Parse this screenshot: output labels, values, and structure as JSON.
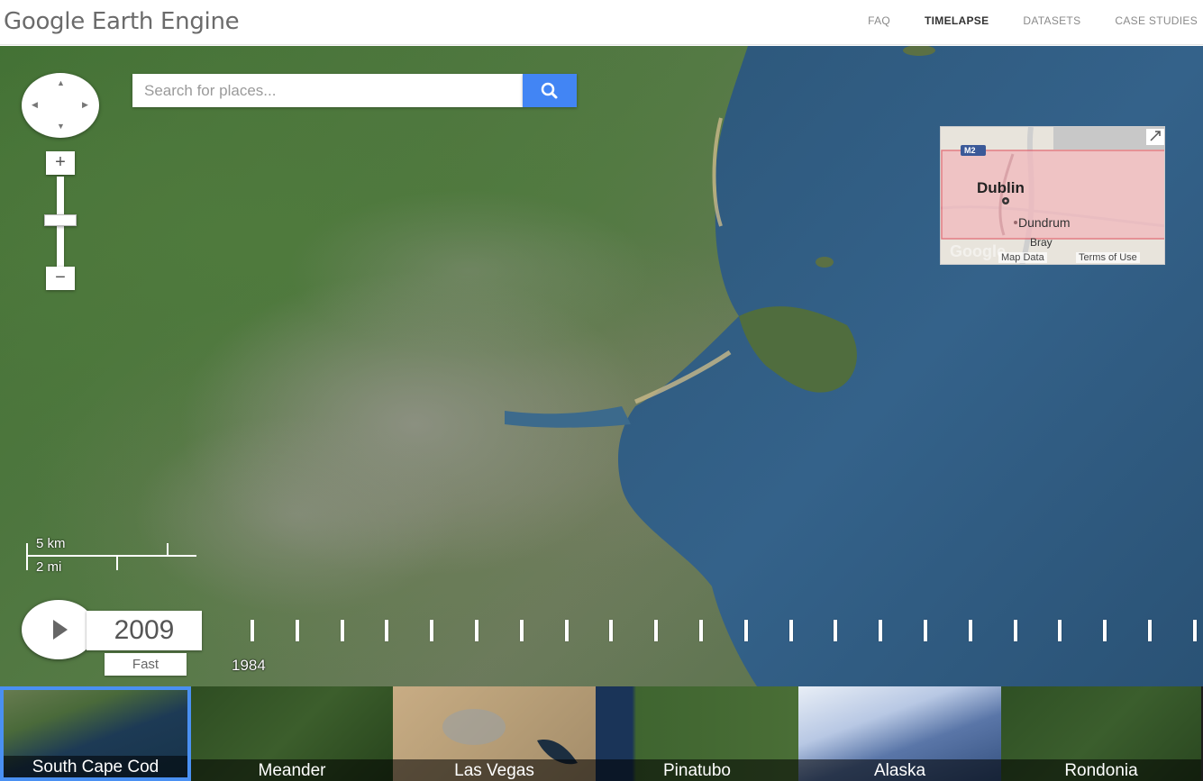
{
  "header": {
    "logo": "Google Earth Engine",
    "nav": [
      "FAQ",
      "TIMELAPSE",
      "DATASETS",
      "CASE STUDIES"
    ],
    "active_nav": "TIMELAPSE"
  },
  "search": {
    "placeholder": "Search for places...",
    "value": ""
  },
  "map": {
    "zoom_level": 0.45
  },
  "minimap": {
    "labels": [
      "Dublin",
      "Dundrum",
      "Bray"
    ],
    "road_badge": "M2",
    "map_data": "Map Data",
    "terms": "Terms of Use",
    "logo_text": "Google"
  },
  "scale": {
    "metric": "5 km",
    "imperial": "2 mi"
  },
  "timeline": {
    "current_year": "2009",
    "speed": "Fast",
    "start_year": "1984",
    "tick_count": 22
  },
  "thumbnails": [
    {
      "label": "South Cape Cod",
      "active": true
    },
    {
      "label": "Meander",
      "active": false
    },
    {
      "label": "Las Vegas",
      "active": false
    },
    {
      "label": "Pinatubo",
      "active": false
    },
    {
      "label": "Alaska",
      "active": false
    },
    {
      "label": "Rondonia",
      "active": false
    }
  ],
  "colors": {
    "accent": "#4285f4",
    "sea": "#2f5a80",
    "land": "#4f7a3d"
  }
}
